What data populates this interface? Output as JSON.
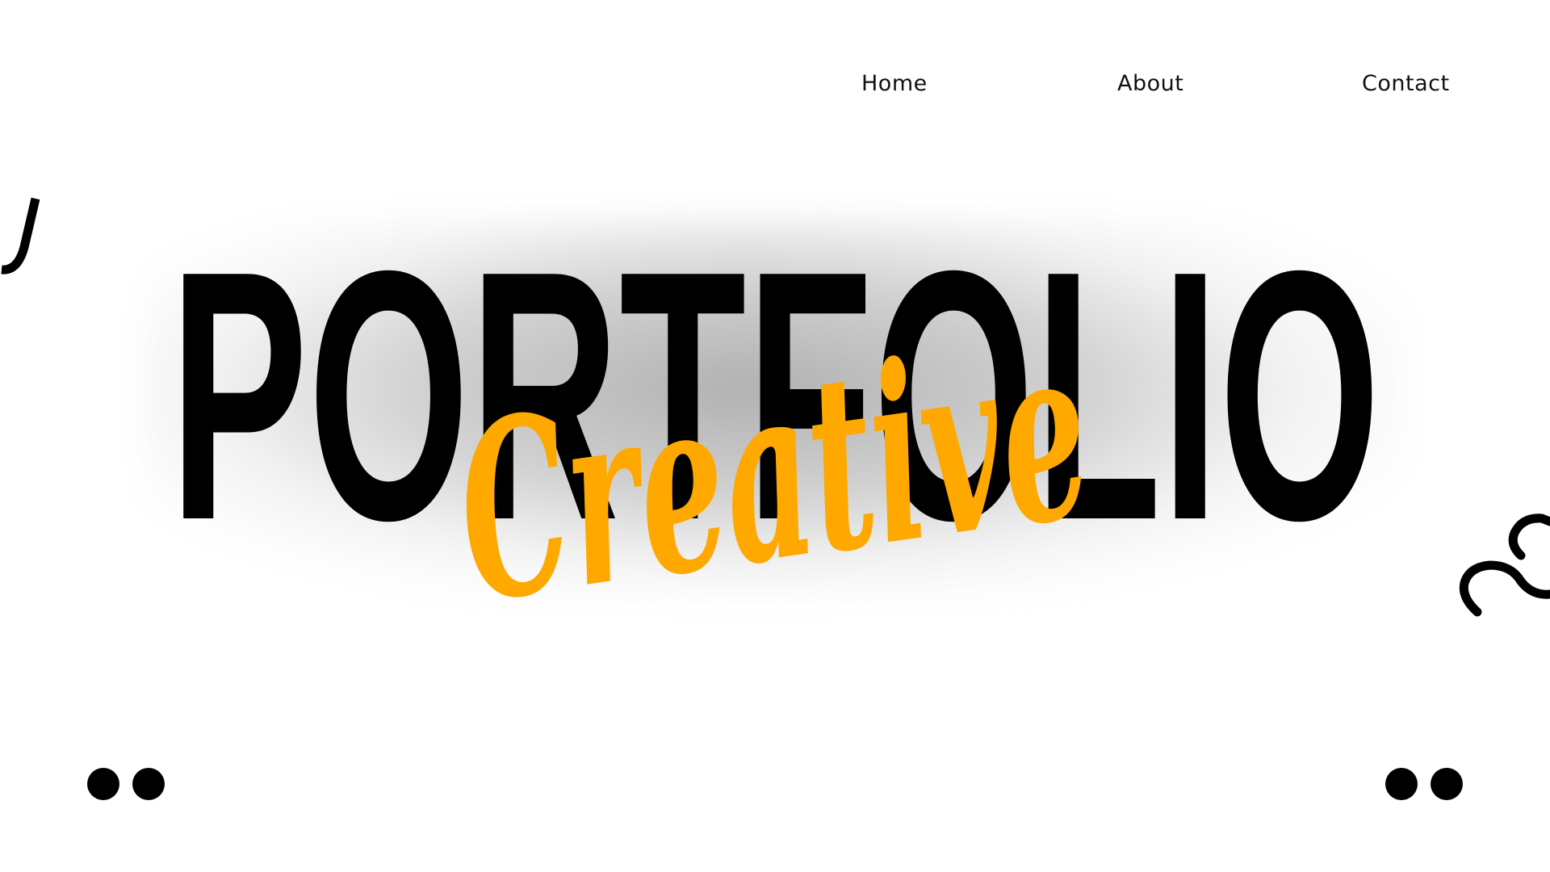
{
  "nav": {
    "home_label": "Home",
    "about_label": "About",
    "contact_label": "Contact"
  },
  "hero": {
    "title": "PORTFOLIO",
    "script_word": "Creative"
  },
  "colors": {
    "title": "#000000",
    "accent": "#FFA800",
    "background": "#FFFFFF",
    "nav_text": "#111111"
  },
  "decorations": {
    "left_squiggle_icon": "squiggle-icon",
    "right_squiggle_icon": "squiggle-icon",
    "left_dots_icon": "two-dots-icon",
    "right_dots_icon": "two-dots-icon"
  }
}
